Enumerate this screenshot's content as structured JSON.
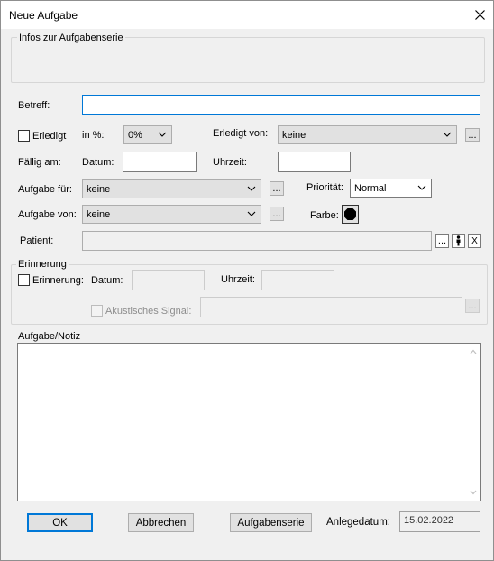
{
  "window": {
    "title": "Neue Aufgabe"
  },
  "serie_group": {
    "legend": "Infos zur Aufgabenserie"
  },
  "betreff": {
    "label": "Betreff:",
    "value": ""
  },
  "erledigt": {
    "label": "Erledigt",
    "checked": false,
    "percent_label": "in %:",
    "percent_value": "0%",
    "von_label": "Erledigt von:",
    "von_value": "keine",
    "browse": "..."
  },
  "faellig": {
    "label": "Fällig am:",
    "datum_label": "Datum:",
    "datum_value": "",
    "uhrzeit_label": "Uhrzeit:",
    "uhrzeit_value": ""
  },
  "aufgabe_fuer": {
    "label": "Aufgabe für:",
    "value": "keine",
    "browse": "..."
  },
  "prioritaet": {
    "label": "Priorität:",
    "value": "Normal"
  },
  "aufgabe_von": {
    "label": "Aufgabe von:",
    "value": "keine",
    "browse": "..."
  },
  "farbe": {
    "label": "Farbe:",
    "color": "#000000"
  },
  "patient": {
    "label": "Patient:",
    "value": "",
    "browse": "...",
    "clear": "X"
  },
  "erinnerung": {
    "legend": "Erinnerung",
    "checkbox_label": "Erinnerung:",
    "checked": false,
    "datum_label": "Datum:",
    "uhrzeit_label": "Uhrzeit:",
    "signal_label": "Akustisches Signal:",
    "signal_checked": false,
    "browse": "..."
  },
  "notiz": {
    "label": "Aufgabe/Notiz",
    "value": ""
  },
  "footer": {
    "ok": "OK",
    "abbrechen": "Abbrechen",
    "aufgabenserie": "Aufgabenserie",
    "anlegedatum_label": "Anlegedatum:",
    "anlegedatum_value": "15.02.2022"
  },
  "colors": {
    "accent": "#0078d7",
    "dialog_bg": "#f0f0f0",
    "button_bg": "#e1e1e1"
  }
}
